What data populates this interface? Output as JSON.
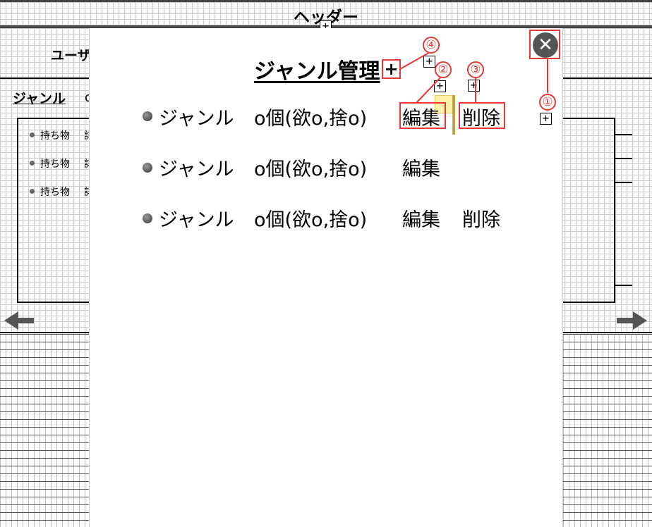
{
  "header": {
    "title": "ヘッダー"
  },
  "background_page": {
    "title": "ユーザ",
    "genre_heading": "ジャンル",
    "genre_suffix": "o",
    "items": [
      {
        "label": "持ち物",
        "tail": "詳"
      },
      {
        "label": "持ち物",
        "tail": "詳"
      },
      {
        "label": "持ち物",
        "tail": "詳"
      }
    ]
  },
  "modal": {
    "title": "ジャンル管理",
    "add_label": "+",
    "close_label": "✕",
    "rows": [
      {
        "name": "ジャンル",
        "count": "o個(欲o,捨o)",
        "edit": "編集",
        "delete": "削除"
      },
      {
        "name": "ジャンル",
        "count": "o個(欲o,捨o)",
        "edit": "編集",
        "delete": ""
      },
      {
        "name": "ジャンル",
        "count": "o個(欲o,捨o)",
        "edit": "編集",
        "delete": "削除"
      }
    ]
  },
  "annotations": {
    "plus_symbol": "+",
    "badges": [
      "①",
      "②",
      "③",
      "④"
    ]
  },
  "colors": {
    "annotation_red": "#e53935",
    "grid": "#c9c9c9",
    "dark": "#555555"
  }
}
